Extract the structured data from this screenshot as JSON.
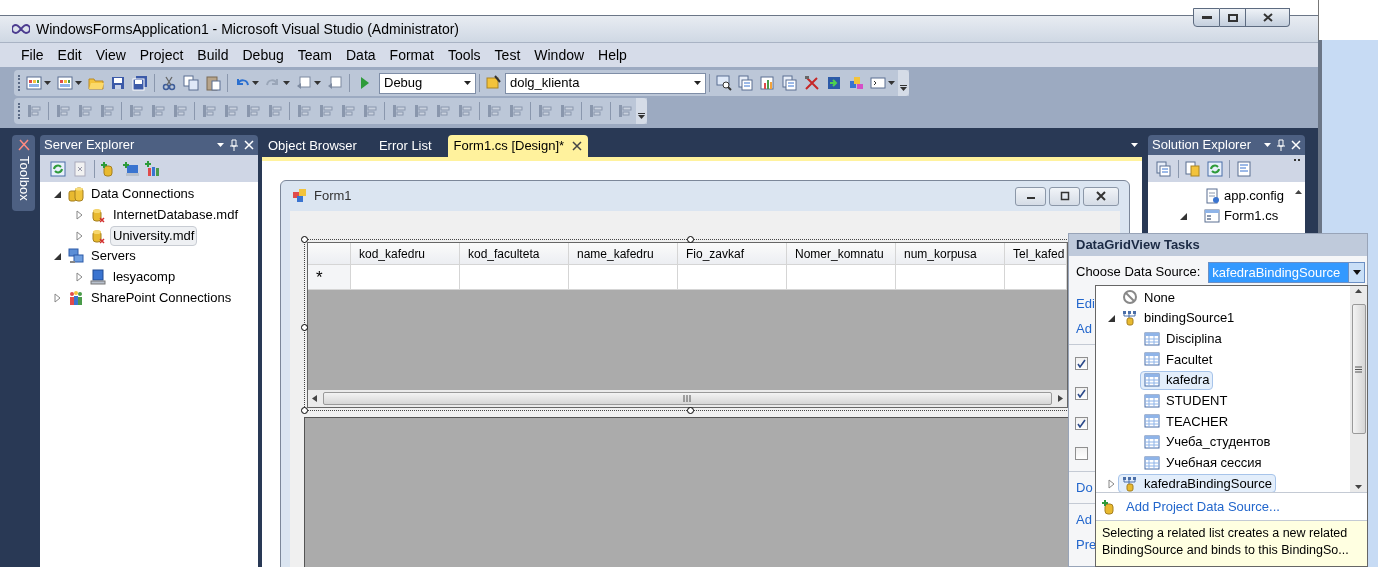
{
  "window": {
    "title": "WindowsFormsApplication1 - Microsoft Visual Studio (Administrator)"
  },
  "menu": [
    "File",
    "Edit",
    "View",
    "Project",
    "Build",
    "Debug",
    "Team",
    "Data",
    "Format",
    "Tools",
    "Test",
    "Window",
    "Help"
  ],
  "toolbar": {
    "configuration": "Debug",
    "find_combo": "dolg_klienta"
  },
  "side_tab": "Toolbox",
  "server_explorer": {
    "title": "Server Explorer",
    "tree": [
      {
        "label": "Data Connections",
        "kind": "connections",
        "expanded": true,
        "selected": false,
        "children": [
          {
            "label": "InternetDatabase.mdf",
            "kind": "database",
            "expanded": false,
            "selected": false
          },
          {
            "label": "University.mdf",
            "kind": "database",
            "expanded": false,
            "selected": true
          }
        ]
      },
      {
        "label": "Servers",
        "kind": "servers",
        "expanded": true,
        "selected": false,
        "children": [
          {
            "label": "lesyacomp",
            "kind": "computer",
            "expanded": false,
            "selected": false
          }
        ]
      },
      {
        "label": "SharePoint Connections",
        "kind": "sharepoint",
        "expanded": false,
        "selected": false
      }
    ]
  },
  "doc_tabs": [
    {
      "label": "Object Browser",
      "selected": false
    },
    {
      "label": "Error List",
      "selected": false
    },
    {
      "label": "Form1.cs [Design]*",
      "selected": true
    }
  ],
  "form": {
    "title": "Form1",
    "grid": {
      "columns": [
        "kod_kafedru",
        "kod_faculteta",
        "name_kafedru",
        "Fio_zavkaf",
        "Nomer_komnatu",
        "num_korpusa",
        "Tel_kafed"
      ],
      "new_row_marker": "*"
    }
  },
  "solution_explorer": {
    "title": "Solution Explorer",
    "items": [
      {
        "label": "app.config",
        "kind": "config",
        "expanded": false
      },
      {
        "label": "Form1.cs",
        "kind": "form",
        "expanded": true
      }
    ]
  },
  "tasks": {
    "title": "DataGridView Tasks",
    "data_source_label": "Choose Data Source:",
    "data_source_value": "kafedraBindingSource",
    "groups": [
      [
        {
          "kind": "link",
          "label": "Edi"
        },
        {
          "kind": "link",
          "label": "Ad"
        }
      ],
      [
        {
          "kind": "checkbox",
          "checked": true
        },
        {
          "kind": "checkbox",
          "checked": true
        },
        {
          "kind": "checkbox",
          "checked": true
        },
        {
          "kind": "checkbox",
          "checked": false
        }
      ],
      [
        {
          "kind": "link",
          "label": "Do"
        }
      ],
      [
        {
          "kind": "link",
          "label": "Ad"
        },
        {
          "kind": "link",
          "label": "Pre"
        }
      ]
    ]
  },
  "data_source_list": {
    "items": [
      {
        "label": "None",
        "kind": "none",
        "selected": false
      },
      {
        "label": "bindingSource1",
        "kind": "binding",
        "expanded": true,
        "selected": false,
        "children": [
          {
            "label": "Disciplina",
            "kind": "table",
            "selected": false
          },
          {
            "label": "Facultet",
            "kind": "table",
            "selected": false
          },
          {
            "label": "kafedra",
            "kind": "table",
            "selected": true
          },
          {
            "label": "STUDENT",
            "kind": "table",
            "selected": false
          },
          {
            "label": "TEACHER",
            "kind": "table",
            "selected": false
          },
          {
            "label": "Учеба_студентов",
            "kind": "table",
            "selected": false
          },
          {
            "label": "Учебная сессия",
            "kind": "table",
            "selected": false
          }
        ]
      },
      {
        "label": "kafedraBindingSource",
        "kind": "binding",
        "expanded": false,
        "selected": true
      }
    ],
    "add_link": "Add Project Data Source...",
    "hint": "Selecting a related list creates a new related BindingSource and binds to this BindingSo..."
  }
}
